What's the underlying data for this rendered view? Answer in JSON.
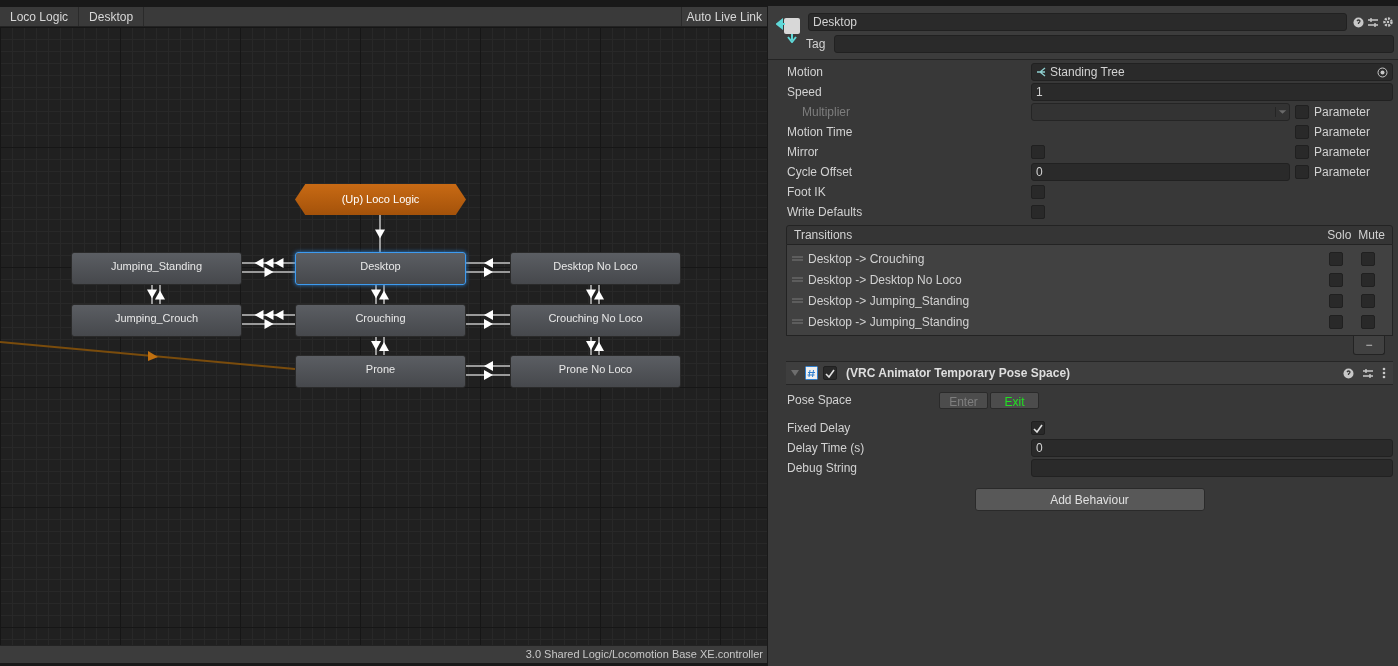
{
  "graph": {
    "breadcrumbs": [
      {
        "label": "Loco Logic"
      },
      {
        "label": "Desktop"
      }
    ],
    "live_link_button": "Auto Live Link",
    "nodes": [
      {
        "label": "(Up) Loco Logic",
        "kind": "parent",
        "selected": false
      },
      {
        "label": "Jumping_Standing",
        "kind": "state",
        "selected": false
      },
      {
        "label": "Desktop",
        "kind": "state",
        "selected": true
      },
      {
        "label": "Desktop No Loco",
        "kind": "state",
        "selected": false
      },
      {
        "label": "Jumping_Crouch",
        "kind": "state",
        "selected": false
      },
      {
        "label": "Crouching",
        "kind": "state",
        "selected": false
      },
      {
        "label": "Crouching No Loco",
        "kind": "state",
        "selected": false
      },
      {
        "label": "Prone",
        "kind": "state",
        "selected": false
      },
      {
        "label": "Prone No Loco",
        "kind": "state",
        "selected": false
      }
    ],
    "status_path": "3.0 Shared Logic/Locomotion Base XE.controller"
  },
  "inspector": {
    "name": "Desktop",
    "tag_label": "Tag",
    "properties": [
      {
        "label": "Motion",
        "kind": "object",
        "value": "Standing Tree",
        "disabled": false
      },
      {
        "label": "Speed",
        "kind": "number",
        "value": "1",
        "disabled": false
      },
      {
        "label": "Multiplier",
        "kind": "dropdown",
        "disabled": true,
        "parameter": {
          "label": "Parameter",
          "checked": false
        }
      },
      {
        "label": "Motion Time",
        "kind": "none",
        "disabled": false,
        "parameter": {
          "label": "Parameter",
          "checked": false
        }
      },
      {
        "label": "Mirror",
        "kind": "checkbox",
        "checked": false,
        "disabled": false,
        "parameter": {
          "label": "Parameter",
          "checked": false
        }
      },
      {
        "label": "Cycle Offset",
        "kind": "number",
        "value": "0",
        "disabled": false,
        "parameter": {
          "label": "Parameter",
          "checked": false
        }
      },
      {
        "label": "Foot IK",
        "kind": "checkbox",
        "checked": false,
        "disabled": false
      },
      {
        "label": "Write Defaults",
        "kind": "checkbox",
        "checked": false,
        "disabled": false
      }
    ],
    "transitions": {
      "title": "Transitions",
      "solo_header": "Solo",
      "mute_header": "Mute",
      "remove_button": "−",
      "items": [
        {
          "label": "Desktop -> Crouching",
          "solo": false,
          "mute": false
        },
        {
          "label": "Desktop -> Desktop No Loco",
          "solo": false,
          "mute": false
        },
        {
          "label": "Desktop -> Jumping_Standing",
          "solo": false,
          "mute": false
        },
        {
          "label": "Desktop -> Jumping_Standing",
          "solo": false,
          "mute": false
        }
      ]
    },
    "behaviour": {
      "title": "(VRC Animator Temporary Pose Space)",
      "expanded": true,
      "enabled": true,
      "pose_space": {
        "label": "Pose Space",
        "options": [
          {
            "label": "Enter",
            "selected": false
          },
          {
            "label": "Exit",
            "selected": true
          }
        ]
      },
      "fields": [
        {
          "label": "Fixed Delay",
          "kind": "checkbox",
          "checked": true
        },
        {
          "label": "Delay Time (s)",
          "kind": "number",
          "value": "0"
        },
        {
          "label": "Debug String",
          "kind": "text"
        }
      ]
    },
    "add_button": "Add Behaviour"
  }
}
